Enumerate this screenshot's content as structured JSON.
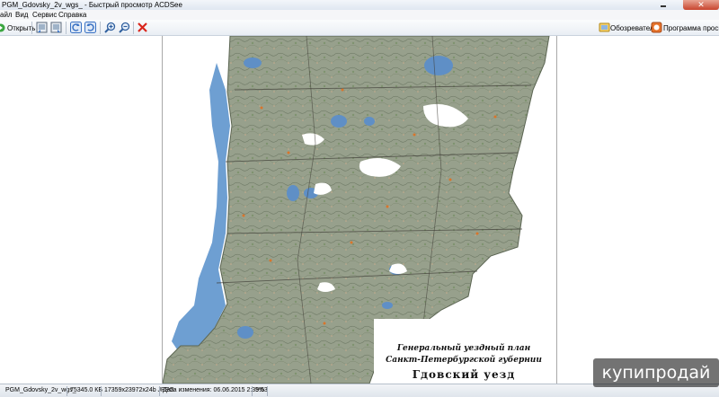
{
  "window": {
    "title": "PGM_Gdovsky_2v_wgs_ - Быстрый просмотр ACDSee",
    "close_glyph": "✕"
  },
  "menu": {
    "items": [
      "айл",
      "Вид",
      "Сервис",
      "Справка"
    ]
  },
  "toolbar": {
    "open_label": "Открыть",
    "browser_label": "Обозреватель",
    "viewer_label": "Программа просмотр"
  },
  "map": {
    "caption_line1": "Генеральный уездный план",
    "caption_line2": "Санкт-Петербургской губернии",
    "caption_line3": "Гдовский уезд"
  },
  "status": {
    "filename": "PGM_Gdovsky_2v_wgs_",
    "filesize": "75345.0 КБ",
    "dimensions": "17359x23972x24b JPEG",
    "modified": "Дата изменения: 06.06.2015 2:39:53",
    "zoom": "5%"
  },
  "watermark": {
    "text": "купипродай"
  },
  "colors": {
    "toolbar_blue": "#3a72c4",
    "close_red": "#c8452e",
    "delete_red": "#d9261c"
  }
}
